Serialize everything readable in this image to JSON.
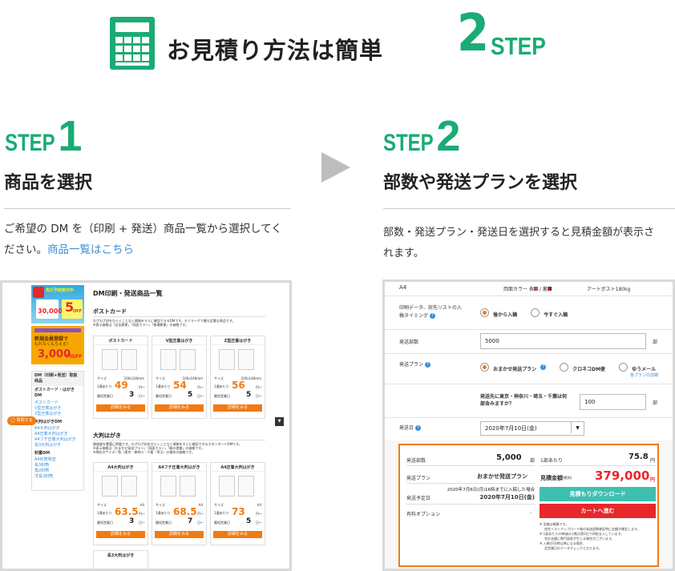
{
  "header": {
    "title": "お見積り方法は簡単",
    "big_number": "2",
    "step_word": "STEP",
    "accent": "#1bab74"
  },
  "step1": {
    "label": "STEP",
    "number": "1",
    "heading": "商品を選択",
    "desc_line1": "ご希望の DM を（印刷 + 発送）商品一覧から選択してく",
    "desc_line2": "ださい。",
    "link": "商品一覧はこちら"
  },
  "step2": {
    "label": "STEP",
    "number": "2",
    "heading": "部数や発送プランを選択",
    "desc_line1": "部数・発送プラン・発送日を選択すると見積金額が表示さ",
    "desc_line2": "れます。"
  },
  "left_shot": {
    "page_title": "DM印刷・発送商品一覧",
    "section_postcard": "ポストカード",
    "section_large": "大判はがき",
    "postcard_desc": "わざわざ封をひらくことなく情報をすぐに確認できるDMです。セミマーケで最も定番な商品です。",
    "postcard_desc2": "※表示価格は「広告郵便」「両面カラー」「普通郵便」の価格です。",
    "large_desc": "情報量を豊富に掲載でき、わざわざ封をひらくことなく情報をすぐに確認できるスタンダードDMです。",
    "large_desc2": "※表示価格は「おまかせ発送プラン」「両面カラー」「郵の差額」の価格です。",
    "large_desc3": "※現在のサイズ一覧（東京・神奈川・千葉・埼玉）の場合の価格です。",
    "cards_row1": [
      {
        "name": "ポストカード",
        "size": "100x148mm",
        "price": "49",
        "days": "3"
      },
      {
        "name": "V型圧着はがき",
        "size": "100x148mm",
        "price": "54",
        "days": "5"
      },
      {
        "name": "Z型圧着はがき",
        "size": "100x148mm",
        "price": "56",
        "days": "5"
      }
    ],
    "cards_row2": [
      {
        "name": "A4大判はがき",
        "size": "A4",
        "price": "63.5",
        "days": "3"
      },
      {
        "name": "A4フチ圧着大判はがき",
        "size": "A4",
        "price": "68.5",
        "days": "7"
      },
      {
        "name": "A4圧着大判はがき",
        "size": "A4",
        "price": "73",
        "days": "5"
      }
    ],
    "card_size_label": "サイズ",
    "card_price_label": "1通あたり",
    "card_days_label": "最短営業日",
    "card_price_unit": "円～",
    "card_days_unit": "日～",
    "card_button": "詳細をみる",
    "last_card": "長3大判はがき",
    "ad1_line1": "先行予約受付中",
    "ad1_line2": "30,000",
    "ad1_badge": "5",
    "ad1_badge2": "OFF",
    "ad2_line1": "新規会員登録で",
    "ad2_line2": "もれなくもらえる！",
    "ad2_amount": "3,000",
    "ad2_off": "円OFF",
    "sidebar_head": "DM（印刷+発送）取扱商品",
    "sidebar_group1": "ポストカード・はがきDM",
    "sidebar_items1": [
      "ポストカード",
      "V型圧着はがき",
      "Z型圧着はがき"
    ],
    "sidebar_group2": "大判はがきDM",
    "sidebar_items2": [
      "A4大判はがき",
      "A4圧着大判はがき",
      "A4フチ圧着大判はがき",
      "長3大判はがき"
    ],
    "sidebar_group3": "封書DM",
    "sidebar_items3": [
      "A4封筒発送",
      "長3封筒",
      "角2封筒",
      "洋長3封筒"
    ],
    "chat_button": "質問する",
    "scroll_btn": "▼"
  },
  "right_shot": {
    "top_size": "A4",
    "top_color": "両面カラー 表",
    "top_color2": "/ 裏",
    "top_paper": "アートポスト180kg",
    "timing_label": "印刷データ、宛先リストの入稿タイミング",
    "timing_opt1": "後から入稿",
    "timing_opt2": "今すぐ入稿",
    "qty_label": "発送部数",
    "qty_value": "5000",
    "qty_unit": "部",
    "plan_label": "発送プラン",
    "plan_opt1": "おまかせ発送プラン",
    "plan_opt2": "クロネコDM便",
    "plan_opt3": "ゆうメール",
    "plan_detail": "各プランの詳細",
    "region_label": "発送先に東京・神奈川・埼玉・千葉は何部含みますか？",
    "region_value": "100",
    "region_unit": "部",
    "date_label": "発送日",
    "date_value": "2020年7月10日(金)",
    "sum_qty_label": "発送部数",
    "sum_qty": "5,000",
    "sum_qty_unit": "部",
    "sum_plan_label": "発送プラン",
    "sum_plan": "おまかせ発送プラン",
    "sum_note": "2020年7月6日(月)16時までに入稿した場合",
    "sum_date_label": "発送予定日",
    "sum_date": "2020年7月10日(金)",
    "sum_option_label": "有料オプション",
    "sum_option": "-",
    "unit_label": "1部あたり",
    "unit_price": "75.8",
    "unit_yen": "円",
    "total_label": "見積金額",
    "total_tax": "(税別)",
    "total_price": "379,000",
    "total_yen": "円",
    "btn_download": "見積もりダウンロード",
    "btn_cart": "カートへ進む",
    "notes": [
      "※ 金額は概算です。",
      "宛先リストアップロード後の発送部数確定時に金額が確定します。",
      "※ 1部あたりの単価は小数点第2位で四捨五入しています。",
      "合計金額に数円誤差が生じる場合がございます。",
      "※ 入稿が16時以降になる場合、",
      "翌営業日のデータチェックとなります。"
    ],
    "colors": {
      "orange": "#f07b14",
      "red": "#e8272b",
      "teal": "#3fbfb0"
    }
  }
}
